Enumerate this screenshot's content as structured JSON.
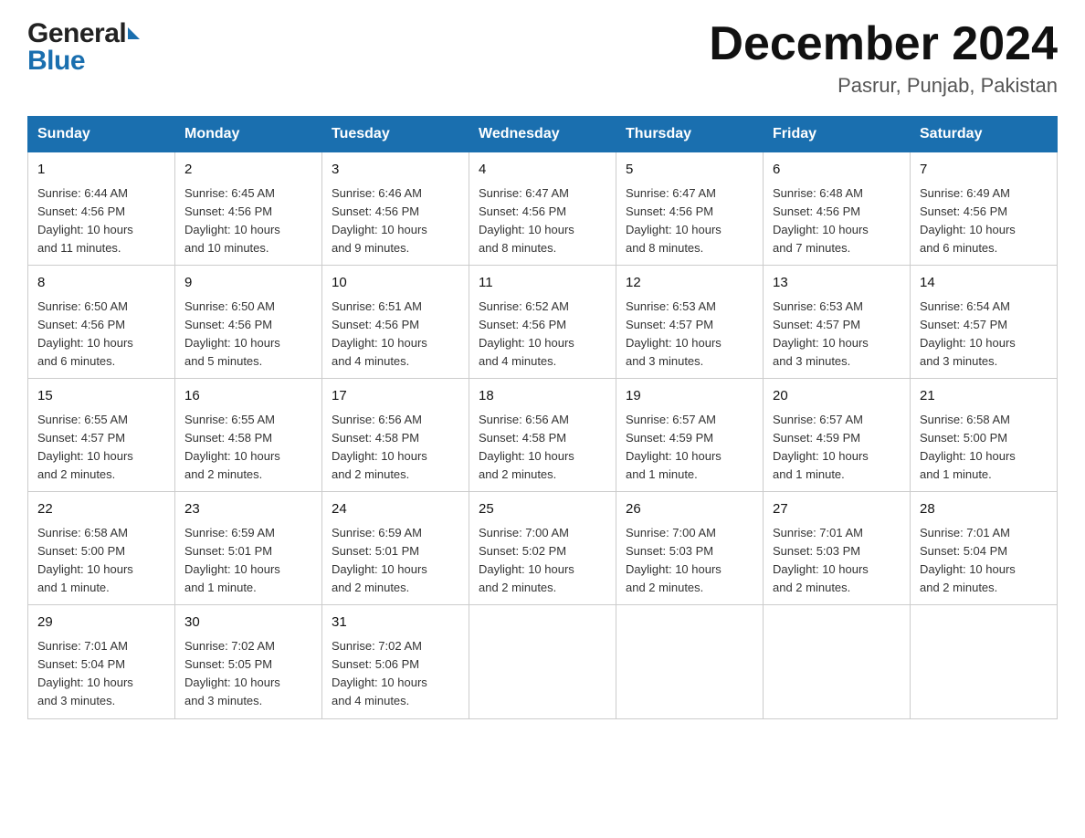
{
  "header": {
    "title": "December 2024",
    "subtitle": "Pasrur, Punjab, Pakistan",
    "logo_general": "General",
    "logo_blue": "Blue"
  },
  "days_of_week": [
    "Sunday",
    "Monday",
    "Tuesday",
    "Wednesday",
    "Thursday",
    "Friday",
    "Saturday"
  ],
  "weeks": [
    [
      {
        "day": "1",
        "sunrise": "6:44 AM",
        "sunset": "4:56 PM",
        "daylight": "10 hours and 11 minutes."
      },
      {
        "day": "2",
        "sunrise": "6:45 AM",
        "sunset": "4:56 PM",
        "daylight": "10 hours and 10 minutes."
      },
      {
        "day": "3",
        "sunrise": "6:46 AM",
        "sunset": "4:56 PM",
        "daylight": "10 hours and 9 minutes."
      },
      {
        "day": "4",
        "sunrise": "6:47 AM",
        "sunset": "4:56 PM",
        "daylight": "10 hours and 8 minutes."
      },
      {
        "day": "5",
        "sunrise": "6:47 AM",
        "sunset": "4:56 PM",
        "daylight": "10 hours and 8 minutes."
      },
      {
        "day": "6",
        "sunrise": "6:48 AM",
        "sunset": "4:56 PM",
        "daylight": "10 hours and 7 minutes."
      },
      {
        "day": "7",
        "sunrise": "6:49 AM",
        "sunset": "4:56 PM",
        "daylight": "10 hours and 6 minutes."
      }
    ],
    [
      {
        "day": "8",
        "sunrise": "6:50 AM",
        "sunset": "4:56 PM",
        "daylight": "10 hours and 6 minutes."
      },
      {
        "day": "9",
        "sunrise": "6:50 AM",
        "sunset": "4:56 PM",
        "daylight": "10 hours and 5 minutes."
      },
      {
        "day": "10",
        "sunrise": "6:51 AM",
        "sunset": "4:56 PM",
        "daylight": "10 hours and 4 minutes."
      },
      {
        "day": "11",
        "sunrise": "6:52 AM",
        "sunset": "4:56 PM",
        "daylight": "10 hours and 4 minutes."
      },
      {
        "day": "12",
        "sunrise": "6:53 AM",
        "sunset": "4:57 PM",
        "daylight": "10 hours and 3 minutes."
      },
      {
        "day": "13",
        "sunrise": "6:53 AM",
        "sunset": "4:57 PM",
        "daylight": "10 hours and 3 minutes."
      },
      {
        "day": "14",
        "sunrise": "6:54 AM",
        "sunset": "4:57 PM",
        "daylight": "10 hours and 3 minutes."
      }
    ],
    [
      {
        "day": "15",
        "sunrise": "6:55 AM",
        "sunset": "4:57 PM",
        "daylight": "10 hours and 2 minutes."
      },
      {
        "day": "16",
        "sunrise": "6:55 AM",
        "sunset": "4:58 PM",
        "daylight": "10 hours and 2 minutes."
      },
      {
        "day": "17",
        "sunrise": "6:56 AM",
        "sunset": "4:58 PM",
        "daylight": "10 hours and 2 minutes."
      },
      {
        "day": "18",
        "sunrise": "6:56 AM",
        "sunset": "4:58 PM",
        "daylight": "10 hours and 2 minutes."
      },
      {
        "day": "19",
        "sunrise": "6:57 AM",
        "sunset": "4:59 PM",
        "daylight": "10 hours and 1 minute."
      },
      {
        "day": "20",
        "sunrise": "6:57 AM",
        "sunset": "4:59 PM",
        "daylight": "10 hours and 1 minute."
      },
      {
        "day": "21",
        "sunrise": "6:58 AM",
        "sunset": "5:00 PM",
        "daylight": "10 hours and 1 minute."
      }
    ],
    [
      {
        "day": "22",
        "sunrise": "6:58 AM",
        "sunset": "5:00 PM",
        "daylight": "10 hours and 1 minute."
      },
      {
        "day": "23",
        "sunrise": "6:59 AM",
        "sunset": "5:01 PM",
        "daylight": "10 hours and 1 minute."
      },
      {
        "day": "24",
        "sunrise": "6:59 AM",
        "sunset": "5:01 PM",
        "daylight": "10 hours and 2 minutes."
      },
      {
        "day": "25",
        "sunrise": "7:00 AM",
        "sunset": "5:02 PM",
        "daylight": "10 hours and 2 minutes."
      },
      {
        "day": "26",
        "sunrise": "7:00 AM",
        "sunset": "5:03 PM",
        "daylight": "10 hours and 2 minutes."
      },
      {
        "day": "27",
        "sunrise": "7:01 AM",
        "sunset": "5:03 PM",
        "daylight": "10 hours and 2 minutes."
      },
      {
        "day": "28",
        "sunrise": "7:01 AM",
        "sunset": "5:04 PM",
        "daylight": "10 hours and 2 minutes."
      }
    ],
    [
      {
        "day": "29",
        "sunrise": "7:01 AM",
        "sunset": "5:04 PM",
        "daylight": "10 hours and 3 minutes."
      },
      {
        "day": "30",
        "sunrise": "7:02 AM",
        "sunset": "5:05 PM",
        "daylight": "10 hours and 3 minutes."
      },
      {
        "day": "31",
        "sunrise": "7:02 AM",
        "sunset": "5:06 PM",
        "daylight": "10 hours and 4 minutes."
      },
      null,
      null,
      null,
      null
    ]
  ],
  "labels": {
    "sunrise": "Sunrise:",
    "sunset": "Sunset:",
    "daylight": "Daylight:"
  }
}
